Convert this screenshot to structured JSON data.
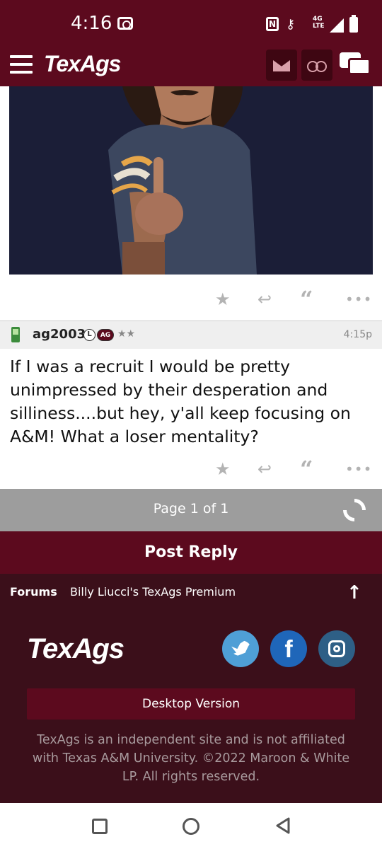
{
  "status_bar": {
    "time": "4:16",
    "network_label": "4G LTE",
    "icons": [
      "screen-record-icon",
      "nfc-icon",
      "vpn-key-icon",
      "signal-icon",
      "battery-icon"
    ]
  },
  "header": {
    "logo": "TexAgs",
    "icons": [
      "menu-icon",
      "mail-icon",
      "binoculars-icon",
      "chat-icon"
    ],
    "brand_color": "#5c0a1e"
  },
  "post_actions": [
    "star-icon",
    "reply-icon",
    "quote-icon",
    "more-icon"
  ],
  "post": {
    "username": "ag2003",
    "badge_l": "L",
    "badge_ag": "AG",
    "stars": "★★",
    "time": "4:15p",
    "body": "If I was a recruit I would be pretty unimpressed by their desperation and silliness....but hey, y'all keep focusing on A&M! What a loser mentality?"
  },
  "pager": {
    "label": "Page 1 of 1"
  },
  "reply": {
    "label": "Post Reply"
  },
  "breadcrumb": {
    "forums": "Forums",
    "board": "Billy Liucci's TexAgs Premium"
  },
  "footer": {
    "logo": "TexAgs",
    "facebook_glyph": "f",
    "social": [
      "twitter-icon",
      "facebook-icon",
      "instagram-icon"
    ],
    "desktop_version": "Desktop Version",
    "disclaimer": "TexAgs is an independent site and is not affiliated with Texas A&M University. ©2022 Maroon & White LP. All rights reserved."
  },
  "colors": {
    "maroon": "#5c0a1e",
    "footer_bg": "#3b0f1a",
    "pager_bg": "#9d9d9d"
  }
}
